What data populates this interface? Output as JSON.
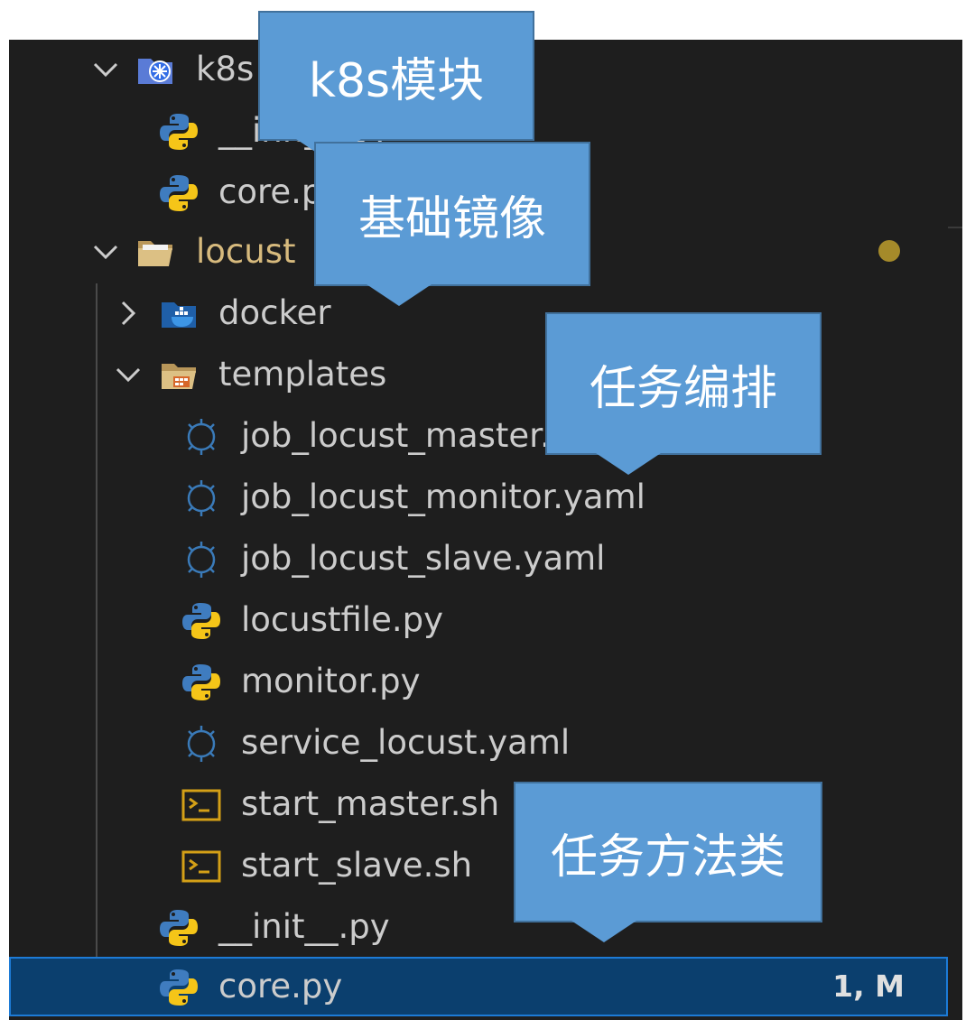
{
  "explorer": {
    "items": [
      {
        "label": "k8s",
        "kind": "folder",
        "icon": "kubernetes-folder-icon",
        "expanded": true
      },
      {
        "label": "__init__.py",
        "kind": "file",
        "icon": "python-file-icon"
      },
      {
        "label": "core.py",
        "kind": "file",
        "icon": "python-file-icon"
      },
      {
        "label": "locust",
        "kind": "folder",
        "icon": "folder-open-icon",
        "expanded": true,
        "modified": true
      },
      {
        "label": "docker",
        "kind": "folder",
        "icon": "docker-folder-icon",
        "expanded": false
      },
      {
        "label": "templates",
        "kind": "folder",
        "icon": "templates-folder-icon",
        "expanded": true
      },
      {
        "label": "job_locust_master.yaml",
        "kind": "file",
        "icon": "helm-icon"
      },
      {
        "label": "job_locust_monitor.yaml",
        "kind": "file",
        "icon": "helm-icon"
      },
      {
        "label": "job_locust_slave.yaml",
        "kind": "file",
        "icon": "helm-icon"
      },
      {
        "label": "locustfile.py",
        "kind": "file",
        "icon": "python-file-icon"
      },
      {
        "label": "monitor.py",
        "kind": "file",
        "icon": "python-file-icon"
      },
      {
        "label": "service_locust.yaml",
        "kind": "file",
        "icon": "helm-icon"
      },
      {
        "label": "start_master.sh",
        "kind": "file",
        "icon": "shell-script-icon"
      },
      {
        "label": "start_slave.sh",
        "kind": "file",
        "icon": "shell-script-icon"
      },
      {
        "label": "__init__.py",
        "kind": "file",
        "icon": "python-file-icon"
      },
      {
        "label": "core.py",
        "kind": "file",
        "icon": "python-file-icon",
        "selected": true,
        "badge": "1, M"
      }
    ]
  },
  "helm_icon_text": "HELM",
  "callouts": {
    "k8s_module": "k8s模块",
    "base_image": "基础镜像",
    "task_orchestration": "任务编排",
    "task_method_class": "任务方法类"
  },
  "colors": {
    "background": "#1e1e1e",
    "text": "#cccccc",
    "modified": "#d7ba7d",
    "selection": "#0b3f6e",
    "callout": "#5b9bd5",
    "python_blue": "#3572a5",
    "python_yellow": "#ffd43b"
  }
}
